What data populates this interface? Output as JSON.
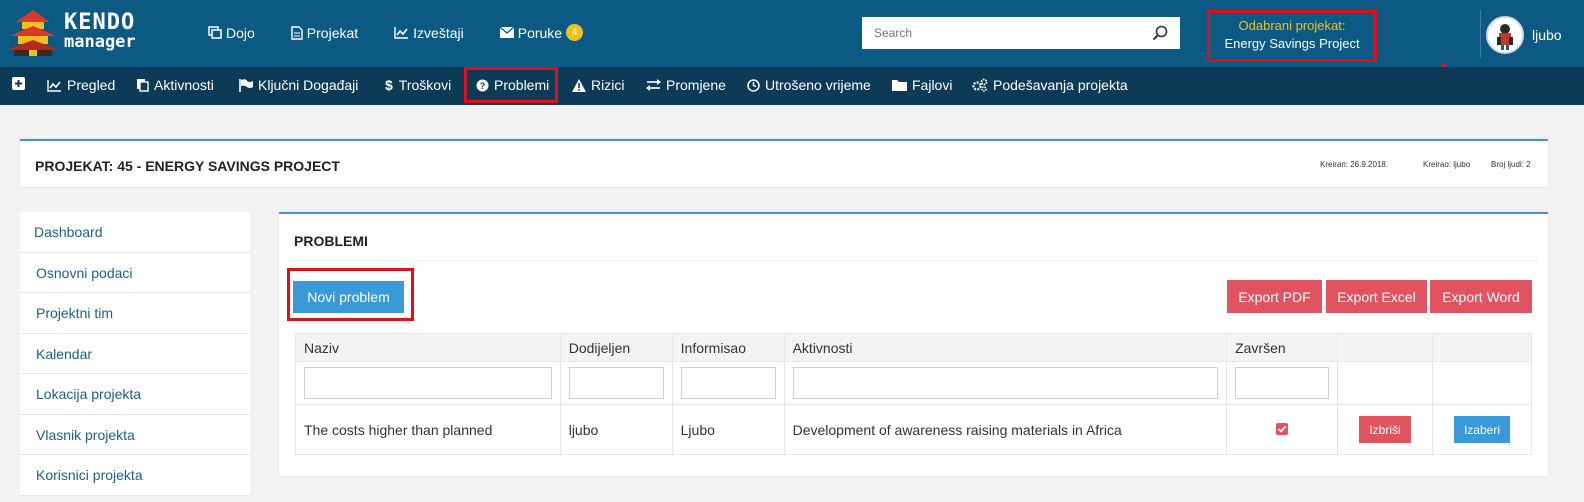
{
  "brand": {
    "logo_line1": "KENDO",
    "logo_line2": "manager",
    "header_bg": "#0c5a84",
    "subnav_bg": "#0d3a57",
    "accent_red": "#e25360",
    "accent_blue": "#3a99d8",
    "highlight_border": "#e0101a"
  },
  "topnav": {
    "items": [
      {
        "label": "Dojo",
        "icon": "windows-icon"
      },
      {
        "label": "Projekat",
        "icon": "document-icon"
      },
      {
        "label": "Izveštaji",
        "icon": "chart-icon"
      },
      {
        "label": "Poruke",
        "icon": "envelope-icon",
        "badge": "4"
      }
    ]
  },
  "search": {
    "placeholder": "Search"
  },
  "project_selector": {
    "label": "Odabrani projekat:",
    "value": "Energy Savings Project"
  },
  "user": {
    "name": "ljubo"
  },
  "subnav": {
    "items": [
      {
        "label": "",
        "icon": "plus-icon"
      },
      {
        "label": "Pregled",
        "icon": "chart-icon"
      },
      {
        "label": "Aktivnosti",
        "icon": "copy-icon"
      },
      {
        "label": "Ključni Događaji",
        "icon": "flag-icon"
      },
      {
        "label": "Troškovi",
        "icon": "dollar-icon"
      },
      {
        "label": "Problemi",
        "icon": "question-circle-icon",
        "active": true
      },
      {
        "label": "Rizici",
        "icon": "warning-icon"
      },
      {
        "label": "Promjene",
        "icon": "exchange-icon"
      },
      {
        "label": "Utrošeno vrijeme",
        "icon": "clock-icon"
      },
      {
        "label": "Fajlovi",
        "icon": "folder-icon"
      },
      {
        "label": "Podešavanja projekta",
        "icon": "gears-icon"
      }
    ]
  },
  "project_header": {
    "title": "PROJEKAT: 45 - ENERGY SAVINGS PROJECT",
    "created": "Kreiran: 26.9.2018.",
    "created_by": "Kreirao: ljubo",
    "people_count": "Broj ljudi: 2"
  },
  "sidebar": {
    "items": [
      {
        "label": "Dashboard"
      },
      {
        "label": "Osnovni podaci"
      },
      {
        "label": "Projektni tim"
      },
      {
        "label": "Kalendar"
      },
      {
        "label": "Lokacija projekta"
      },
      {
        "label": "Vlasnik projekta"
      },
      {
        "label": "Korisnici projekta"
      }
    ]
  },
  "panel": {
    "title": "PROBLEMI",
    "new_button": "Novi problem",
    "export_pdf": "Export PDF",
    "export_excel": "Export Excel",
    "export_word": "Export Word"
  },
  "table": {
    "columns": [
      "Naziv",
      "Dodijeljen",
      "Informisao",
      "Aktivnosti",
      "Završen",
      "",
      ""
    ],
    "rows": [
      {
        "naziv": "The costs higher than planned",
        "dodijeljen": "ljubo",
        "informisao": "Ljubo",
        "aktivnosti": "Development of awareness raising materials in Africa",
        "zavrsen": true,
        "delete_label": "Izbriši",
        "select_label": "Izaberi"
      }
    ]
  }
}
